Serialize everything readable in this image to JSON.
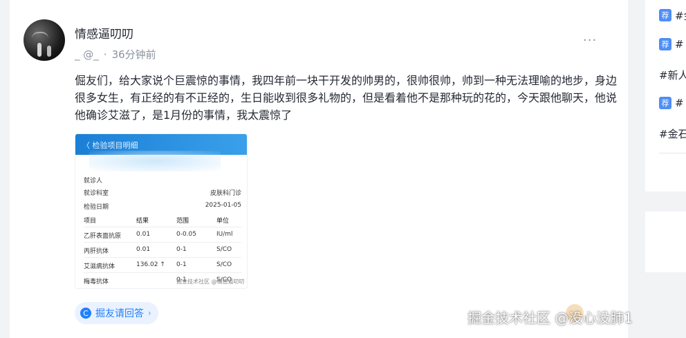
{
  "post": {
    "username": "情感逼叨叨",
    "handle": "_ @_",
    "time": "36分钟前",
    "more_label": "···",
    "content": "倔友们，给大家说个巨震惊的事情，我四年前一块干开发的帅男的，很帅很帅，帅到一种无法理喻的地步，身边很多女生，有正经的有不正经的，生日能收到很多礼物的，但是看着他不是那种玩的花的，今天跟他聊天，他说他确诊艾滋了，是1月份的事情，我太震惊了",
    "image": {
      "title": "〈 检验项目明细",
      "patient_label": "就诊人",
      "dept_label": "就诊科室",
      "dept_value": "皮肤科门诊",
      "date_label": "检验日期",
      "date_value": "2025-01-05",
      "headers": [
        "项目",
        "结果",
        "范围",
        "单位"
      ],
      "rows": [
        [
          "乙肝表面抗原",
          "0.01",
          "0-0.05",
          "IU/ml"
        ],
        [
          "丙肝抗体",
          "0.01",
          "0-1",
          "S/CO"
        ],
        [
          "艾滋病抗体",
          "136.02 ↑",
          "0-1",
          "S/CO"
        ],
        [
          "梅毒抗体",
          "",
          "0-1",
          "S/CO"
        ]
      ],
      "watermark": "掘金技术社区 @情感逼叨叨"
    },
    "answer_button": "掘友请回答",
    "answer_icon": "C",
    "answer_chevron": "›"
  },
  "sidebar": {
    "rec_label": "荐",
    "tags": [
      "#金",
      "#",
      "#新人",
      "#",
      "#金石"
    ]
  },
  "watermark": "掘金技术社区 @没心没肺1"
}
